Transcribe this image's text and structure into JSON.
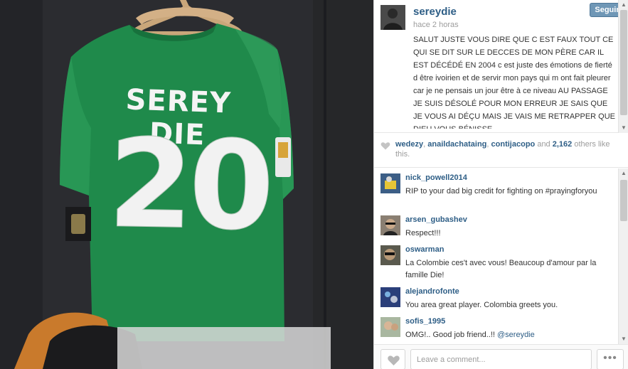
{
  "post": {
    "username": "sereydie",
    "follow_label": "Seguir",
    "timestamp": "hace 2 horas",
    "caption": "SALUT JUSTE VOUS DIRE QUE C EST FAUX TOUT CE QUI SE DIT SUR LE DECCES DE MON PÈRE CAR IL EST DÉCÉDÉ EN 2004 c est juste des émotions de fierté d être ivoirien et de servir mon pays qui m ont fait pleurer car je ne pensais un jour être à ce niveau AU PASSAGE JE SUIS DÉSOLÉ POUR MON ERREUR JE SAIS QUE JE VOUS AI DÉÇU MAIS JE VAIS ME RETRAPPER QUE DIEU VOUS BÉNISSE"
  },
  "photo": {
    "jersey_name": "SEREY DIE",
    "jersey_number": "20",
    "colors": {
      "jersey": "#1f8a4b",
      "background": "#2a2b2f"
    }
  },
  "likes": {
    "users": [
      "wedezy",
      "anaildachataing",
      "contijacopo"
    ],
    "sep1": ", ",
    "sep2": ", ",
    "and_text": " and ",
    "count": "2,162",
    "suffix": " others like this."
  },
  "comments": [
    {
      "user": "nick_powell2014",
      "text": "RIP to your dad big credit for fighting on #prayingforyou"
    },
    {
      "user": "arsen_gubashev",
      "text": "Respect!!!"
    },
    {
      "user": "oswarman",
      "text": "La Colombie ces't avec vous! Beaucoup d'amour par la famille Die!"
    },
    {
      "user": "alejandrofonte",
      "text": "You area great player. Colombia greets you."
    },
    {
      "user": "sofis_1995",
      "text": "OMG!.. Good job friend..!! ",
      "mention": "@sereydie"
    }
  ],
  "footer": {
    "comment_placeholder": "Leave a comment...",
    "more_label": "•••"
  },
  "icons": {
    "heart": "heart-icon",
    "more": "ellipsis-icon"
  },
  "colors": {
    "link": "#2e5e86",
    "follow_button": "#6f97b6",
    "muted": "#9c9c9c"
  }
}
